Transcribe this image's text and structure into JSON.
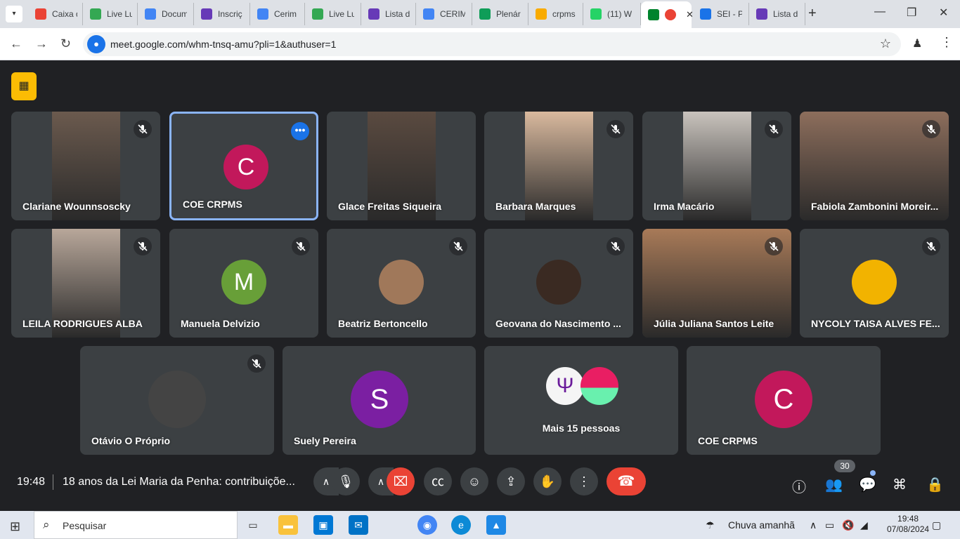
{
  "browser": {
    "tabs": [
      {
        "label": "Caixa d",
        "icon": "gmail-icon",
        "color": "#ea4335"
      },
      {
        "label": "Live Lu",
        "icon": "drive-icon",
        "color": "#34a853"
      },
      {
        "label": "Docum",
        "icon": "docs-icon",
        "color": "#4285f4"
      },
      {
        "label": "Inscriç",
        "icon": "forms-icon",
        "color": "#673ab7"
      },
      {
        "label": "Cerim",
        "icon": "docs-icon",
        "color": "#4285f4"
      },
      {
        "label": "Live Lu",
        "icon": "drive-icon",
        "color": "#34a853"
      },
      {
        "label": "Lista d",
        "icon": "forms-icon",
        "color": "#673ab7"
      },
      {
        "label": "CERIM",
        "icon": "docs-icon",
        "color": "#4285f4"
      },
      {
        "label": "Plenár",
        "icon": "sheets-icon",
        "color": "#0f9d58"
      },
      {
        "label": "crpms",
        "icon": "calendar-icon",
        "color": "#f9ab00"
      },
      {
        "label": "(11) W",
        "icon": "whatsapp-icon",
        "color": "#25d366"
      },
      {
        "label": "",
        "icon": "meet-icon",
        "color": "#00832d",
        "active": true
      },
      {
        "label": "SEI - P",
        "icon": "sei-icon",
        "color": "#1a73e8"
      },
      {
        "label": "Lista d",
        "icon": "forms-icon",
        "color": "#673ab7"
      }
    ],
    "url": "meet.google.com/whm-tnsq-amu?pli=1&authuser=1"
  },
  "participants": [
    {
      "name": "Clariane Wounnsoscky",
      "muted": true,
      "type": "video",
      "bg": "#6b5a4e"
    },
    {
      "name": "COE CRPMS",
      "muted": false,
      "type": "avatar",
      "initial": "C",
      "color": "#c2185b",
      "selected": true
    },
    {
      "name": "Glace Freitas Siqueira",
      "muted": false,
      "type": "video",
      "bg": "#5a4a40"
    },
    {
      "name": "Barbara Marques",
      "muted": true,
      "type": "video",
      "bg": "#d9b99e"
    },
    {
      "name": "Irma Macário",
      "muted": true,
      "type": "video",
      "bg": "#c9c3bd"
    },
    {
      "name": "Fabiola Zambonini Moreir...",
      "muted": true,
      "type": "video",
      "bg": "#8d6e5c"
    },
    {
      "name": "LEILA RODRIGUES ALBA",
      "muted": true,
      "type": "video",
      "bg": "#b8a79a"
    },
    {
      "name": "Manuela Delvizio",
      "muted": true,
      "type": "avatar",
      "initial": "M",
      "color": "#689f38"
    },
    {
      "name": "Beatriz Bertoncello",
      "muted": true,
      "type": "photo",
      "color": "#a0785a"
    },
    {
      "name": "Geovana do Nascimento ...",
      "muted": true,
      "type": "photo",
      "color": "#3a2a22"
    },
    {
      "name": "Júlia Juliana Santos Leite",
      "muted": true,
      "type": "video",
      "bg": "#a87a58"
    },
    {
      "name": "NYCOLY TAISA ALVES FE...",
      "muted": true,
      "type": "photo",
      "color": "#f2b300"
    },
    {
      "name": "Otávio O Próprio",
      "muted": true,
      "type": "photo",
      "color": "#444444"
    },
    {
      "name": "Suely Pereira",
      "muted": false,
      "type": "avatar",
      "initial": "S",
      "color": "#7b1fa2"
    },
    {
      "name": "Mais 15 pessoas",
      "muted": false,
      "type": "group"
    },
    {
      "name": "COE CRPMS",
      "muted": false,
      "type": "avatar",
      "initial": "C",
      "color": "#c2185b"
    }
  ],
  "meeting": {
    "time": "19:48",
    "title": "18 anos da Lei Maria da Penha: contribuiçõe...",
    "participant_count": "30"
  },
  "taskbar": {
    "search_placeholder": "Pesquisar",
    "weather": "Chuva amanhã",
    "clock_time": "19:48",
    "clock_date": "07/08/2024"
  }
}
